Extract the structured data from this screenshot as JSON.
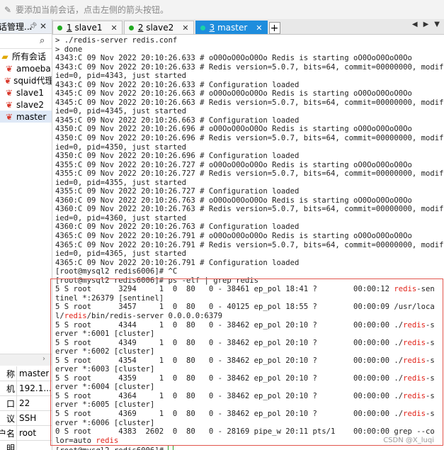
{
  "topbar": {
    "message": "要添加当前会话，点击左侧的箭头按钮。"
  },
  "sidebar": {
    "title": "话管理...",
    "tree_root": "所有会话",
    "items": [
      "amoeba",
      "squid代理",
      "slave1",
      "slave2",
      "master"
    ],
    "properties": [
      {
        "key": "称",
        "value": "master"
      },
      {
        "key": "机",
        "value": "192.1..."
      },
      {
        "key": "口",
        "value": "22"
      },
      {
        "key": "议",
        "value": "SSH"
      },
      {
        "key": "户名",
        "value": "root"
      },
      {
        "key": "明",
        "value": ""
      }
    ]
  },
  "tabs": [
    {
      "num": "1",
      "name": "slave1",
      "active": false
    },
    {
      "num": "2",
      "name": "slave2",
      "active": false
    },
    {
      "num": "3",
      "name": "master",
      "active": true
    }
  ],
  "terminal": {
    "lines": [
      {
        "t": "> ./redis-server redis.conf"
      },
      {
        "t": "> done"
      },
      {
        "t": "4343:C 09 Nov 2022 20:10:26.633 # oO0OoO0OoO0Oo Redis is starting oO0OoO0OoO0Oo"
      },
      {
        "t": "4343:C 09 Nov 2022 20:10:26.633 # Redis version=5.0.7, bits=64, commit=00000000, modif"
      },
      {
        "t": "ied=0, pid=4343, just started"
      },
      {
        "t": "4343:C 09 Nov 2022 20:10:26.633 # Configuration loaded"
      },
      {
        "t": "4345:C 09 Nov 2022 20:10:26.663 # oO0OoO0OoO0Oo Redis is starting oO0OoO0OoO0Oo"
      },
      {
        "t": "4345:C 09 Nov 2022 20:10:26.663 # Redis version=5.0.7, bits=64, commit=00000000, modif"
      },
      {
        "t": "ied=0, pid=4345, just started"
      },
      {
        "t": "4345:C 09 Nov 2022 20:10:26.663 # Configuration loaded"
      },
      {
        "t": "4350:C 09 Nov 2022 20:10:26.696 # oO0OoO0OoO0Oo Redis is starting oO0OoO0OoO0Oo"
      },
      {
        "t": "4350:C 09 Nov 2022 20:10:26.696 # Redis version=5.0.7, bits=64, commit=00000000, modif"
      },
      {
        "t": "ied=0, pid=4350, just started"
      },
      {
        "t": "4350:C 09 Nov 2022 20:10:26.696 # Configuration loaded"
      },
      {
        "t": "4355:C 09 Nov 2022 20:10:26.727 # oO0OoO0OoO0Oo Redis is starting oO0OoO0OoO0Oo"
      },
      {
        "t": "4355:C 09 Nov 2022 20:10:26.727 # Redis version=5.0.7, bits=64, commit=00000000, modif"
      },
      {
        "t": "ied=0, pid=4355, just started"
      },
      {
        "t": "4355:C 09 Nov 2022 20:10:26.727 # Configuration loaded"
      },
      {
        "t": "4360:C 09 Nov 2022 20:10:26.763 # oO0OoO0OoO0Oo Redis is starting oO0OoO0OoO0Oo"
      },
      {
        "t": "4360:C 09 Nov 2022 20:10:26.763 # Redis version=5.0.7, bits=64, commit=00000000, modif"
      },
      {
        "t": "ied=0, pid=4360, just started"
      },
      {
        "t": "4360:C 09 Nov 2022 20:10:26.763 # Configuration loaded"
      },
      {
        "t": "4365:C 09 Nov 2022 20:10:26.791 # oO0OoO0OoO0Oo Redis is starting oO0OoO0OoO0Oo"
      },
      {
        "t": "4365:C 09 Nov 2022 20:10:26.791 # Redis version=5.0.7, bits=64, commit=00000000, modif"
      },
      {
        "t": "ied=0, pid=4365, just started"
      },
      {
        "t": "4365:C 09 Nov 2022 20:10:26.791 # Configuration loaded"
      },
      {
        "t": "[root@mysql2 redis6006]# ^C"
      },
      {
        "t": "[root@mysql2 redis6006]# ps -elf | grep redis"
      },
      {
        "t": "5 S root      3294     1  0  80   0 - 38461 ep_pol 18:41 ?        00:00:12 ",
        "hl": "redis",
        "rest": "-sen"
      },
      {
        "t": "tinel *:26379 [sentinel]"
      },
      {
        "t": "5 S root      3457     1  0  80   0 - 40125 ep_pol 18:55 ?        00:00:09 /usr/loca"
      },
      {
        "t": "l/",
        "hl": "redis",
        "rest": "/bin/redis-server 0.0.0.0:6379"
      },
      {
        "t": "5 S root      4344     1  0  80   0 - 38462 ep_pol 20:10 ?        00:00:00 ./",
        "hl": "redis",
        "rest": "-s"
      },
      {
        "t": "erver *:6001 [cluster]"
      },
      {
        "t": "5 S root      4349     1  0  80   0 - 38462 ep_pol 20:10 ?        00:00:00 ./",
        "hl": "redis",
        "rest": "-s"
      },
      {
        "t": "erver *:6002 [cluster]"
      },
      {
        "t": "5 S root      4354     1  0  80   0 - 38462 ep_pol 20:10 ?        00:00:00 ./",
        "hl": "redis",
        "rest": "-s"
      },
      {
        "t": "erver *:6003 [cluster]"
      },
      {
        "t": "5 S root      4359     1  0  80   0 - 38462 ep_pol 20:10 ?        00:00:00 ./",
        "hl": "redis",
        "rest": "-s"
      },
      {
        "t": "erver *:6004 [cluster]"
      },
      {
        "t": "5 S root      4364     1  0  80   0 - 38462 ep_pol 20:10 ?        00:00:00 ./",
        "hl": "redis",
        "rest": "-s"
      },
      {
        "t": "erver *:6005 [cluster]"
      },
      {
        "t": "5 S root      4369     1  0  80   0 - 38462 ep_pol 20:10 ?        00:00:00 ./",
        "hl": "redis",
        "rest": "-s"
      },
      {
        "t": "erver *:6006 [cluster]"
      },
      {
        "t": "0 S root      4383  2602  0  80   0 - 28169 pipe_w 20:11 pts/1    00:00:00 grep --co"
      },
      {
        "t": "lor=auto ",
        "hl": "redis",
        "rest": ""
      },
      {
        "t": "[root@mysql2 redis6006]# ",
        "cursor": true
      }
    ]
  },
  "watermark": "CSDN @X_luqi",
  "colors": {
    "accent": "#1e8ddd",
    "highlight": "#e2231a"
  }
}
